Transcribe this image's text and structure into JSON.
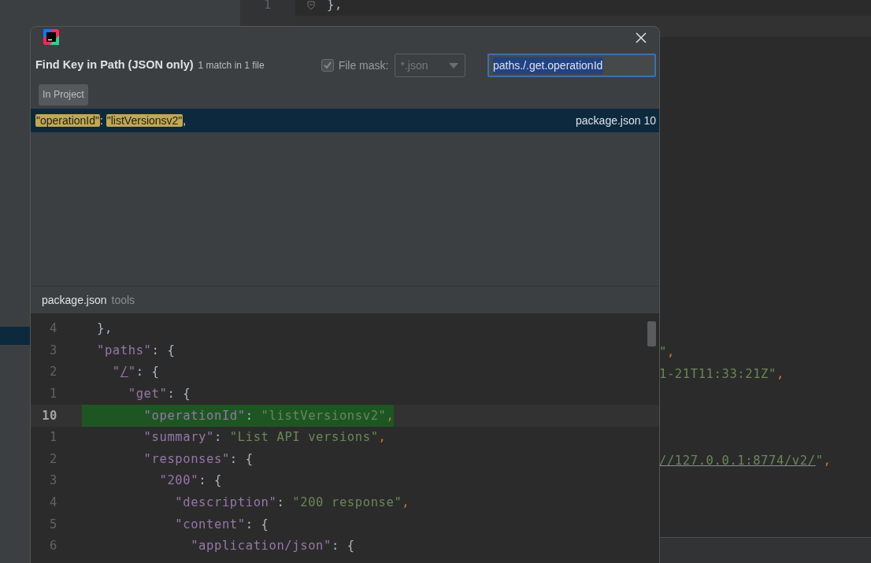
{
  "background_editor": {
    "top_lines": [
      {
        "number": "1",
        "tokens": [
          {
            "kind": "punct",
            "text": "},"
          }
        ]
      }
    ],
    "right_fragments": [
      {
        "tokens": [
          {
            "kind": "string",
            "text": "\""
          },
          {
            "kind": "comma",
            "text": ","
          }
        ]
      },
      {
        "tokens": [
          {
            "kind": "string",
            "text": "1-21T11:33:21Z\""
          },
          {
            "kind": "comma",
            "text": ","
          }
        ]
      },
      {
        "tokens": [
          {
            "kind": "string_link",
            "text": "//127.0.0.1:8774/v2/"
          },
          {
            "kind": "string",
            "text": "\""
          },
          {
            "kind": "comma",
            "text": ","
          }
        ]
      }
    ]
  },
  "dialog": {
    "title": "Find Key in Path (JSON only)",
    "match_summary": "1 match in 1 file",
    "file_mask": {
      "checked": true,
      "disabled": true,
      "label": "File mask:",
      "value": "*.json"
    },
    "search_field": {
      "value": "paths./.get.operationId",
      "focused": true
    },
    "scope_button": "In Project",
    "results": [
      {
        "selected": true,
        "segments": [
          {
            "text": "\"operationId\"",
            "highlighted": true
          },
          {
            "text": ": ",
            "highlighted": false
          },
          {
            "text": "\"listVersionsv2\"",
            "highlighted": true
          },
          {
            "text": ",",
            "highlighted": false
          }
        ],
        "location": "package.json 10"
      }
    ],
    "preview": {
      "file_name": "package.json",
      "folder": "tools",
      "lines": [
        {
          "number": "4",
          "current": false,
          "tokens": [
            {
              "kind": "punct",
              "text": "},"
            }
          ]
        },
        {
          "number": "3",
          "current": false,
          "tokens": [
            {
              "kind": "key",
              "text": "\"paths\""
            },
            {
              "kind": "punct",
              "text": ": {"
            }
          ]
        },
        {
          "number": "2",
          "current": false,
          "tokens": [
            {
              "kind": "key",
              "text": "  \""
            },
            {
              "kind": "key_link",
              "text": "/"
            },
            {
              "kind": "key",
              "text": "\""
            },
            {
              "kind": "punct",
              "text": ": {"
            }
          ]
        },
        {
          "number": "1",
          "current": false,
          "tokens": [
            {
              "kind": "key",
              "text": "    \"get\""
            },
            {
              "kind": "punct",
              "text": ": {"
            }
          ]
        },
        {
          "number": "10",
          "current": true,
          "tokens": [
            {
              "kind": "key",
              "text": "      \"operationId\""
            },
            {
              "kind": "punct",
              "text": ": "
            },
            {
              "kind": "string",
              "text": "\"listVersionsv2\""
            },
            {
              "kind": "comma",
              "text": ","
            }
          ]
        },
        {
          "number": "1",
          "current": false,
          "tokens": [
            {
              "kind": "key",
              "text": "      \"summary\""
            },
            {
              "kind": "punct",
              "text": ": "
            },
            {
              "kind": "string",
              "text": "\"List API versions\""
            },
            {
              "kind": "comma",
              "text": ","
            }
          ]
        },
        {
          "number": "2",
          "current": false,
          "tokens": [
            {
              "kind": "key",
              "text": "      \"responses\""
            },
            {
              "kind": "punct",
              "text": ": {"
            }
          ]
        },
        {
          "number": "3",
          "current": false,
          "tokens": [
            {
              "kind": "key",
              "text": "        \"200\""
            },
            {
              "kind": "punct",
              "text": ": {"
            }
          ]
        },
        {
          "number": "4",
          "current": false,
          "tokens": [
            {
              "kind": "key",
              "text": "          \"description\""
            },
            {
              "kind": "punct",
              "text": ": "
            },
            {
              "kind": "string",
              "text": "\"200 response\""
            },
            {
              "kind": "comma",
              "text": ","
            }
          ]
        },
        {
          "number": "5",
          "current": false,
          "tokens": [
            {
              "kind": "key",
              "text": "          \"content\""
            },
            {
              "kind": "punct",
              "text": ": {"
            }
          ]
        },
        {
          "number": "6",
          "current": false,
          "tokens": [
            {
              "kind": "key",
              "text": "            \"application/json\""
            },
            {
              "kind": "punct",
              "text": ": {"
            }
          ]
        }
      ]
    }
  }
}
